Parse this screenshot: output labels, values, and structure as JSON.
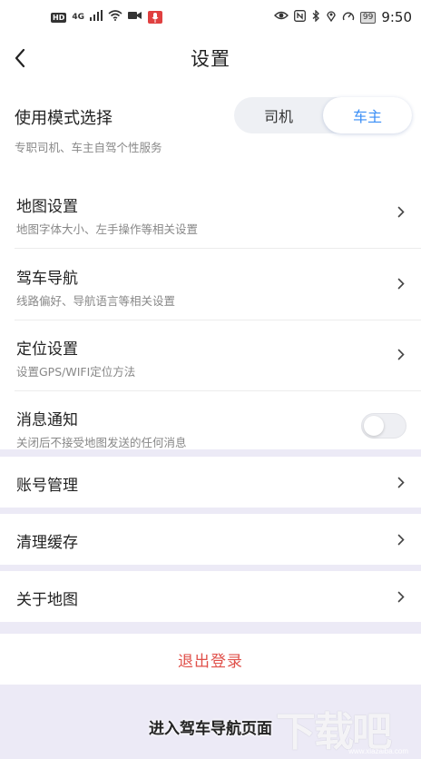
{
  "status_bar": {
    "hd_badge": "HD",
    "network": "4G",
    "battery": "99",
    "time": "9:50"
  },
  "header": {
    "title": "设置"
  },
  "mode": {
    "title": "使用模式选择",
    "subtitle": "专职司机、车主自驾个性服务",
    "options": [
      "司机",
      "车主"
    ],
    "selected": "车主"
  },
  "settings": [
    {
      "title": "地图设置",
      "subtitle": "地图字体大小、左手操作等相关设置"
    },
    {
      "title": "驾车导航",
      "subtitle": "线路偏好、导航语言等相关设置"
    },
    {
      "title": "定位设置",
      "subtitle": "设置GPS/WIFI定位方法"
    },
    {
      "title": "消息通知",
      "subtitle": "关闭后不接受地图发送的任何消息",
      "toggle": false
    }
  ],
  "account": {
    "label": "账号管理"
  },
  "cache": {
    "label": "清理缓存"
  },
  "about": {
    "label": "关于地图"
  },
  "logout": {
    "label": "退出登录"
  },
  "caption": "进入驾车导航页面",
  "watermark": {
    "text": "下载吧",
    "url": "www.xiazaiba.com"
  },
  "colors": {
    "accent": "#3a8ef6",
    "danger": "#e0504a",
    "background": "#eceaf6"
  }
}
